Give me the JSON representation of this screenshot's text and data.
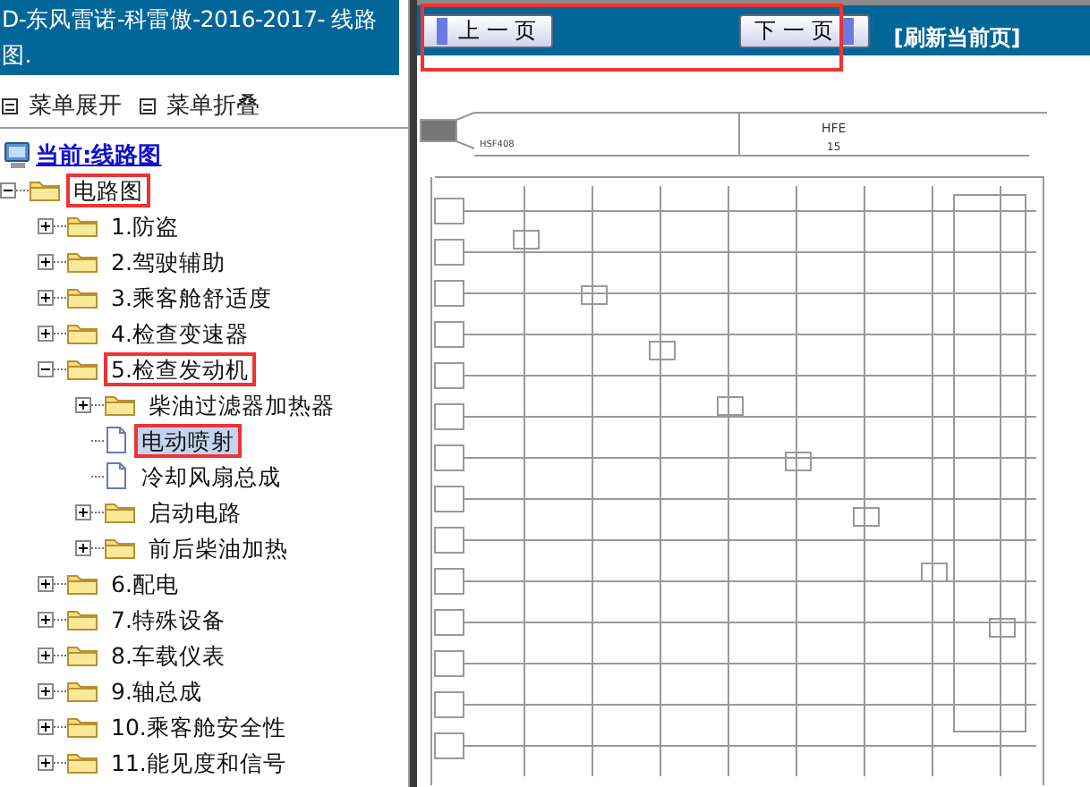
{
  "sidebar": {
    "title": "D-东风雷诺-科雷傲-2016-2017- 线路图.",
    "menu_actions": [
      {
        "label": "菜单展开"
      },
      {
        "label": "菜单折叠"
      }
    ],
    "current": "当前:线路图",
    "tree": [
      {
        "label": "电路图",
        "kind": "folder",
        "expanded": true,
        "selected": false,
        "marked": true,
        "children": [
          {
            "label": "1.防盗",
            "kind": "folder",
            "expanded": false,
            "selected": false,
            "marked": false
          },
          {
            "label": "2.驾驶辅助",
            "kind": "folder",
            "expanded": false,
            "selected": false,
            "marked": false
          },
          {
            "label": "3.乘客舱舒适度",
            "kind": "folder",
            "expanded": false,
            "selected": false,
            "marked": false
          },
          {
            "label": "4.检查变速器",
            "kind": "folder",
            "expanded": false,
            "selected": false,
            "marked": false
          },
          {
            "label": "5.检查发动机",
            "kind": "folder",
            "expanded": true,
            "selected": false,
            "marked": true,
            "children": [
              {
                "label": "柴油过滤器加热器",
                "kind": "folder",
                "expanded": false,
                "selected": false,
                "marked": false
              },
              {
                "label": "电动喷射",
                "kind": "page",
                "selected": true,
                "marked": true
              },
              {
                "label": "冷却风扇总成",
                "kind": "page",
                "selected": false,
                "marked": false
              },
              {
                "label": "启动电路",
                "kind": "folder",
                "expanded": false,
                "selected": false,
                "marked": false
              },
              {
                "label": "前后柴油加热",
                "kind": "folder",
                "expanded": false,
                "selected": false,
                "marked": false
              }
            ]
          },
          {
            "label": "6.配电",
            "kind": "folder",
            "expanded": false,
            "selected": false,
            "marked": false
          },
          {
            "label": "7.特殊设备",
            "kind": "folder",
            "expanded": false,
            "selected": false,
            "marked": false
          },
          {
            "label": "8.车载仪表",
            "kind": "folder",
            "expanded": false,
            "selected": false,
            "marked": false
          },
          {
            "label": "9.轴总成",
            "kind": "folder",
            "expanded": false,
            "selected": false,
            "marked": false
          },
          {
            "label": "10.乘客舱安全性",
            "kind": "folder",
            "expanded": false,
            "selected": false,
            "marked": false
          },
          {
            "label": "11.能见度和信号",
            "kind": "folder",
            "expanded": false,
            "selected": false,
            "marked": false
          }
        ]
      }
    ]
  },
  "viewer": {
    "nav_marked": true,
    "prev_button": "上 一 页",
    "next_button": "下 一 页",
    "refresh_link": "[刷新当前页]",
    "diagram_header": {
      "code": "HSF408",
      "label": "HFE",
      "number": "15"
    }
  }
}
